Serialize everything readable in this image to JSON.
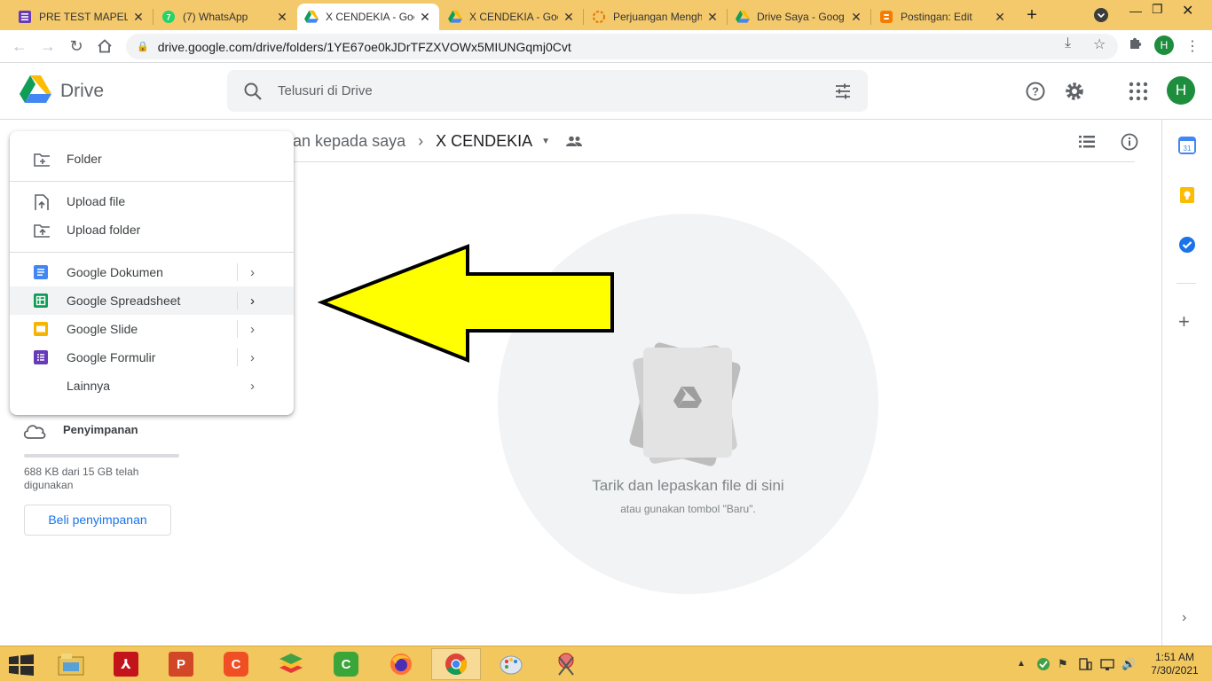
{
  "browser": {
    "tabs": [
      {
        "title": "PRE TEST MAPEL II",
        "icon": "forms-icon"
      },
      {
        "title": "(7) WhatsApp",
        "icon": "whatsapp-icon"
      },
      {
        "title": "X CENDEKIA - Goo",
        "icon": "drive-icon",
        "active": true
      },
      {
        "title": "X CENDEKIA - Goo",
        "icon": "drive-icon"
      },
      {
        "title": "Perjuangan Mengh",
        "icon": "loading-icon"
      },
      {
        "title": "Drive Saya - Goog",
        "icon": "drive-icon"
      },
      {
        "title": "Postingan: Edit",
        "icon": "blogger-icon"
      }
    ],
    "url": "drive.google.com/drive/folders/1YE67oe0kJDrTFZXVOWx5MIUNGqmj0Cvt",
    "profile_initial": "H"
  },
  "drive": {
    "app_name": "Drive",
    "search_placeholder": "Telusuri di Drive",
    "avatar_initial": "H",
    "breadcrumb": {
      "parent": "an kepada saya",
      "current": "X CENDEKIA"
    },
    "empty_state": {
      "title": "Tarik dan lepaskan file di sini",
      "subtitle": "atau gunakan tombol \"Baru\"."
    },
    "storage": {
      "label": "Penyimpanan",
      "usage_text": "688 KB dari 15 GB telah digunakan",
      "used_fraction": 4e-05,
      "buy_button": "Beli penyimpanan"
    },
    "new_menu": {
      "folder": "Folder",
      "upload_file": "Upload file",
      "upload_folder": "Upload folder",
      "docs": "Google Dokumen",
      "sheets": "Google Spreadsheet",
      "slides": "Google Slide",
      "forms": "Google Formulir",
      "more": "Lainnya"
    }
  },
  "taskbar": {
    "time": "1:51 AM",
    "date": "7/30/2021"
  },
  "colors": {
    "tab_strip": "#f4c96b",
    "taskbar": "#f2c75e",
    "accent_blue": "#1a73e8",
    "arrow_yellow": "#ffff00"
  }
}
